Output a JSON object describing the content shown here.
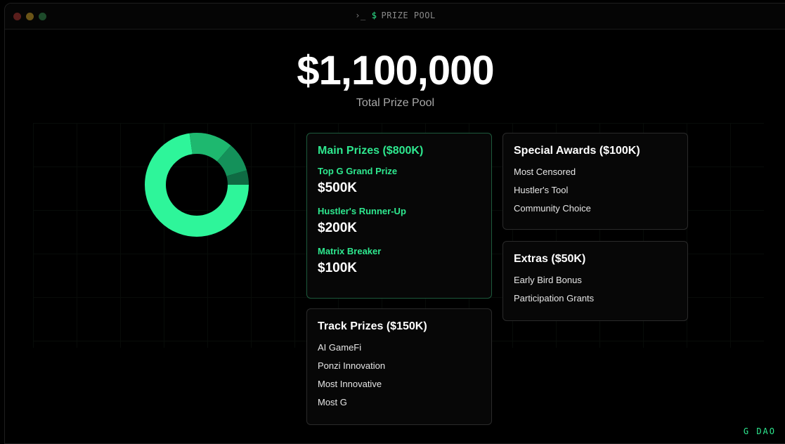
{
  "window": {
    "prompt_glyph": "›_",
    "dollar": "$",
    "title": "PRIZE POOL"
  },
  "hero": {
    "amount": "$1,100,000",
    "subtitle": "Total Prize Pool"
  },
  "chart_data": {
    "type": "pie",
    "style": "donut",
    "series": [
      {
        "values": [
          800,
          150,
          100,
          50
        ],
        "colors": [
          "#2ef59a",
          "#1eb86f",
          "#14915a",
          "#0f6a43"
        ]
      }
    ]
  },
  "cards": {
    "main": {
      "title": "Main Prizes ($800K)",
      "prizes": [
        {
          "label": "Top G Grand Prize",
          "value": "$500K"
        },
        {
          "label": "Hustler's Runner-Up",
          "value": "$200K"
        },
        {
          "label": "Matrix Breaker",
          "value": "$100K"
        }
      ]
    },
    "track": {
      "title": "Track Prizes ($150K)",
      "items": [
        "AI GameFi",
        "Ponzi Innovation",
        "Most Innovative",
        "Most G"
      ]
    },
    "special": {
      "title": "Special Awards ($100K)",
      "items": [
        "Most Censored",
        "Hustler's Tool",
        "Community Choice"
      ]
    },
    "extras": {
      "title": "Extras ($50K)",
      "items": [
        "Early Bird Bonus",
        "Participation Grants"
      ]
    }
  },
  "brand": "G DAO",
  "colors": {
    "accent": "#2ee88f",
    "background": "#000000"
  }
}
